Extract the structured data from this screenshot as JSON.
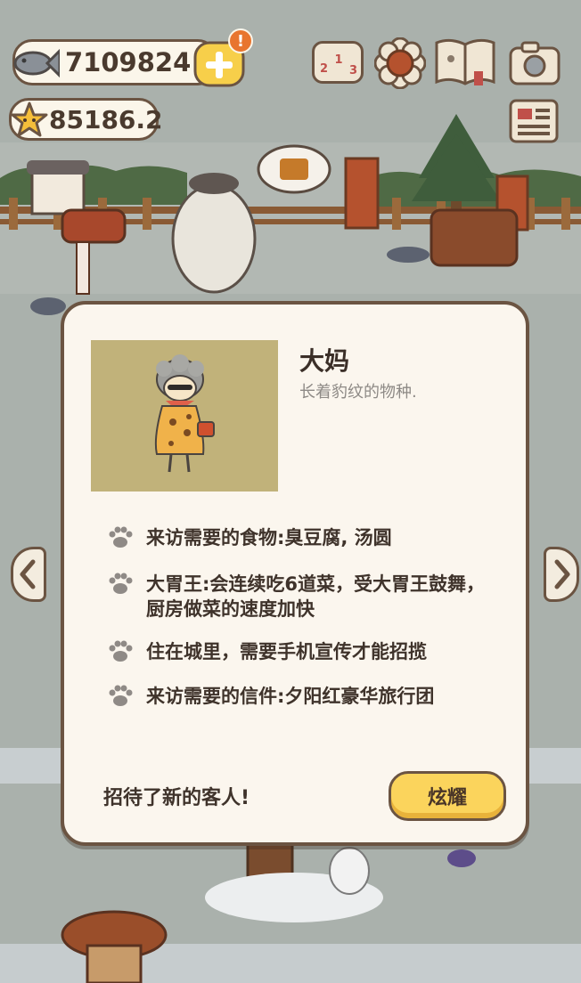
{
  "currency": {
    "fish": "7109824",
    "stars": "85186.2"
  },
  "notification_badge": "!",
  "customer": {
    "name": "大妈",
    "description": "长着豹纹的物种."
  },
  "requirements": [
    "来访需要的食物:臭豆腐, 汤圆",
    "大胃王:会连续吃6道菜，受大胃王鼓舞，厨房做菜的速度加快",
    "住在城里，需要手机宣传才能招揽",
    "来访需要的信件:夕阳红豪华旅行团"
  ],
  "footer_text": "招待了新的客人!",
  "show_off_label": "炫耀",
  "ranking_icon_text": [
    "1",
    "2",
    "3"
  ],
  "colors": {
    "accent_yellow": "#fbd45c",
    "outline": "#6b5442",
    "panel": "#fbf6ee",
    "portrait_bg": "#c1b27a",
    "badge": "#e8752f"
  }
}
